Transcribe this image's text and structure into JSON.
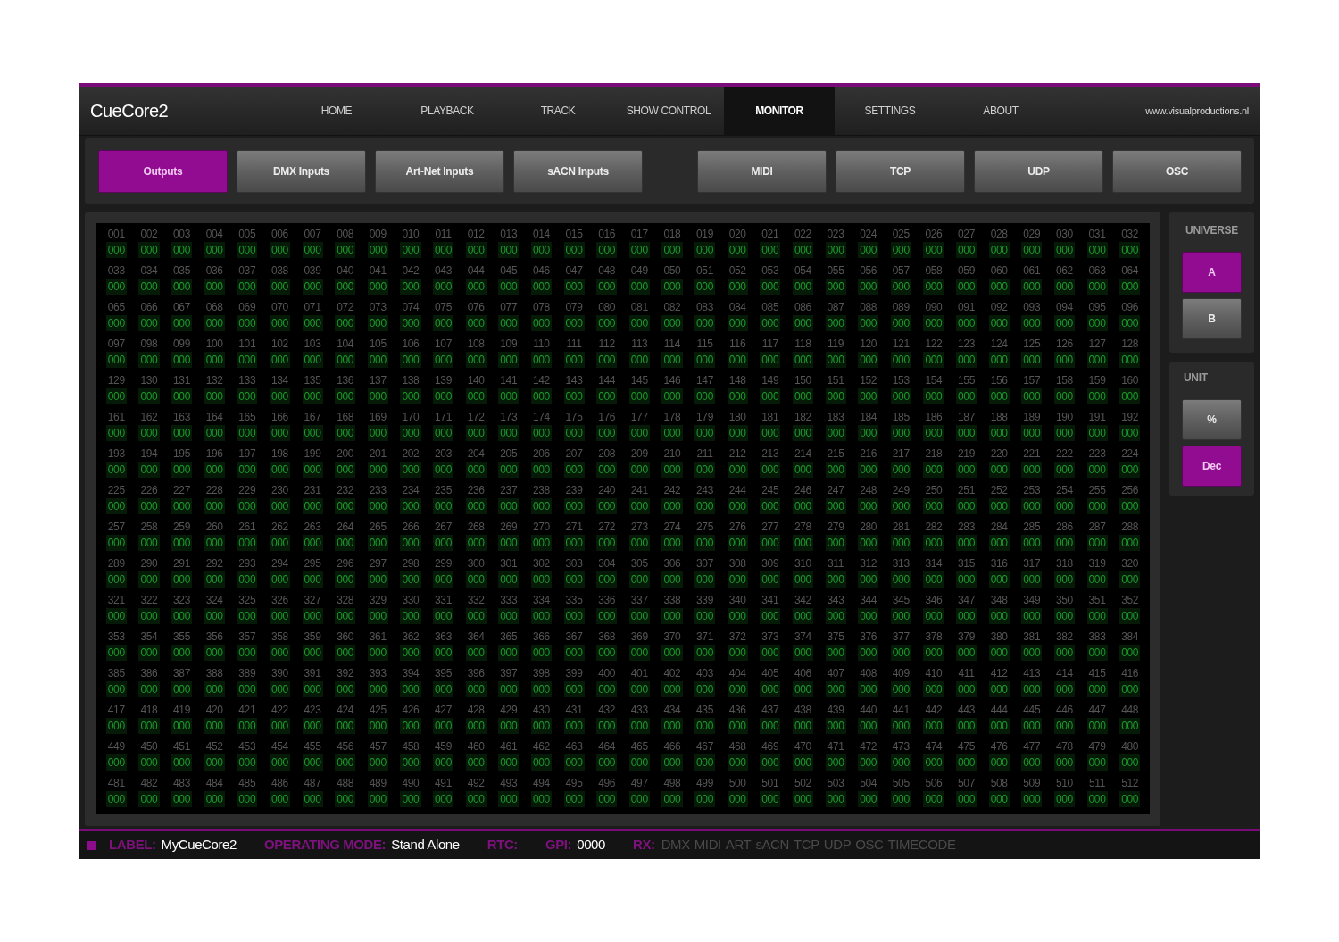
{
  "app": {
    "title": "CueCore2",
    "website": "www.visualproductions.nl"
  },
  "nav_tabs": [
    {
      "label": "HOME",
      "selected": false
    },
    {
      "label": "PLAYBACK",
      "selected": false
    },
    {
      "label": "TRACK",
      "selected": false
    },
    {
      "label": "SHOW CONTROL",
      "selected": false
    },
    {
      "label": "MONITOR",
      "selected": true
    },
    {
      "label": "SETTINGS",
      "selected": false
    },
    {
      "label": "ABOUT",
      "selected": false
    }
  ],
  "channel_tabs": [
    {
      "label": "Outputs",
      "selected": true
    },
    {
      "label": "DMX Inputs",
      "selected": false
    },
    {
      "label": "Art-Net Inputs",
      "selected": false
    },
    {
      "label": "sACN Inputs",
      "selected": false
    }
  ],
  "protocol_tabs": [
    {
      "label": "MIDI",
      "selected": false
    },
    {
      "label": "TCP",
      "selected": false
    },
    {
      "label": "UDP",
      "selected": false
    },
    {
      "label": "OSC",
      "selected": false
    }
  ],
  "channel_rows": [
    {
      "numbers": [
        "001",
        "002",
        "003",
        "004",
        "005",
        "006",
        "007",
        "008",
        "009",
        "010",
        "011",
        "012",
        "013",
        "014",
        "015",
        "016",
        "017",
        "018",
        "019",
        "020",
        "021",
        "022",
        "023",
        "024",
        "025",
        "026",
        "027",
        "028",
        "029",
        "030",
        "031",
        "032"
      ],
      "values": [
        "000",
        "000",
        "000",
        "000",
        "000",
        "000",
        "000",
        "000",
        "000",
        "000",
        "000",
        "000",
        "000",
        "000",
        "000",
        "000",
        "000",
        "000",
        "000",
        "000",
        "000",
        "000",
        "000",
        "000",
        "000",
        "000",
        "000",
        "000",
        "000",
        "000",
        "000",
        "000"
      ]
    },
    {
      "numbers": [
        "033",
        "034",
        "035",
        "036",
        "037",
        "038",
        "039",
        "040",
        "041",
        "042",
        "043",
        "044",
        "045",
        "046",
        "047",
        "048",
        "049",
        "050",
        "051",
        "052",
        "053",
        "054",
        "055",
        "056",
        "057",
        "058",
        "059",
        "060",
        "061",
        "062",
        "063",
        "064"
      ],
      "values": [
        "000",
        "000",
        "000",
        "000",
        "000",
        "000",
        "000",
        "000",
        "000",
        "000",
        "000",
        "000",
        "000",
        "000",
        "000",
        "000",
        "000",
        "000",
        "000",
        "000",
        "000",
        "000",
        "000",
        "000",
        "000",
        "000",
        "000",
        "000",
        "000",
        "000",
        "000",
        "000"
      ]
    },
    {
      "numbers": [
        "065",
        "066",
        "067",
        "068",
        "069",
        "070",
        "071",
        "072",
        "073",
        "074",
        "075",
        "076",
        "077",
        "078",
        "079",
        "080",
        "081",
        "082",
        "083",
        "084",
        "085",
        "086",
        "087",
        "088",
        "089",
        "090",
        "091",
        "092",
        "093",
        "094",
        "095",
        "096"
      ],
      "values": [
        "000",
        "000",
        "000",
        "000",
        "000",
        "000",
        "000",
        "000",
        "000",
        "000",
        "000",
        "000",
        "000",
        "000",
        "000",
        "000",
        "000",
        "000",
        "000",
        "000",
        "000",
        "000",
        "000",
        "000",
        "000",
        "000",
        "000",
        "000",
        "000",
        "000",
        "000",
        "000"
      ]
    },
    {
      "numbers": [
        "097",
        "098",
        "099",
        "100",
        "101",
        "102",
        "103",
        "104",
        "105",
        "106",
        "107",
        "108",
        "109",
        "110",
        "111",
        "112",
        "113",
        "114",
        "115",
        "116",
        "117",
        "118",
        "119",
        "120",
        "121",
        "122",
        "123",
        "124",
        "125",
        "126",
        "127",
        "128"
      ],
      "values": [
        "000",
        "000",
        "000",
        "000",
        "000",
        "000",
        "000",
        "000",
        "000",
        "000",
        "000",
        "000",
        "000",
        "000",
        "000",
        "000",
        "000",
        "000",
        "000",
        "000",
        "000",
        "000",
        "000",
        "000",
        "000",
        "000",
        "000",
        "000",
        "000",
        "000",
        "000",
        "000"
      ]
    },
    {
      "numbers": [
        "129",
        "130",
        "131",
        "132",
        "133",
        "134",
        "135",
        "136",
        "137",
        "138",
        "139",
        "140",
        "141",
        "142",
        "143",
        "144",
        "145",
        "146",
        "147",
        "148",
        "149",
        "150",
        "151",
        "152",
        "153",
        "154",
        "155",
        "156",
        "157",
        "158",
        "159",
        "160"
      ],
      "values": [
        "000",
        "000",
        "000",
        "000",
        "000",
        "000",
        "000",
        "000",
        "000",
        "000",
        "000",
        "000",
        "000",
        "000",
        "000",
        "000",
        "000",
        "000",
        "000",
        "000",
        "000",
        "000",
        "000",
        "000",
        "000",
        "000",
        "000",
        "000",
        "000",
        "000",
        "000",
        "000"
      ]
    },
    {
      "numbers": [
        "161",
        "162",
        "163",
        "164",
        "165",
        "166",
        "167",
        "168",
        "169",
        "170",
        "171",
        "172",
        "173",
        "174",
        "175",
        "176",
        "177",
        "178",
        "179",
        "180",
        "181",
        "182",
        "183",
        "184",
        "185",
        "186",
        "187",
        "188",
        "189",
        "190",
        "191",
        "192"
      ],
      "values": [
        "000",
        "000",
        "000",
        "000",
        "000",
        "000",
        "000",
        "000",
        "000",
        "000",
        "000",
        "000",
        "000",
        "000",
        "000",
        "000",
        "000",
        "000",
        "000",
        "000",
        "000",
        "000",
        "000",
        "000",
        "000",
        "000",
        "000",
        "000",
        "000",
        "000",
        "000",
        "000"
      ]
    },
    {
      "numbers": [
        "193",
        "194",
        "195",
        "196",
        "197",
        "198",
        "199",
        "200",
        "201",
        "202",
        "203",
        "204",
        "205",
        "206",
        "207",
        "208",
        "209",
        "210",
        "211",
        "212",
        "213",
        "214",
        "215",
        "216",
        "217",
        "218",
        "219",
        "220",
        "221",
        "222",
        "223",
        "224"
      ],
      "values": [
        "000",
        "000",
        "000",
        "000",
        "000",
        "000",
        "000",
        "000",
        "000",
        "000",
        "000",
        "000",
        "000",
        "000",
        "000",
        "000",
        "000",
        "000",
        "000",
        "000",
        "000",
        "000",
        "000",
        "000",
        "000",
        "000",
        "000",
        "000",
        "000",
        "000",
        "000",
        "000"
      ]
    },
    {
      "numbers": [
        "225",
        "226",
        "227",
        "228",
        "229",
        "230",
        "231",
        "232",
        "233",
        "234",
        "235",
        "236",
        "237",
        "238",
        "239",
        "240",
        "241",
        "242",
        "243",
        "244",
        "245",
        "246",
        "247",
        "248",
        "249",
        "250",
        "251",
        "252",
        "253",
        "254",
        "255",
        "256"
      ],
      "values": [
        "000",
        "000",
        "000",
        "000",
        "000",
        "000",
        "000",
        "000",
        "000",
        "000",
        "000",
        "000",
        "000",
        "000",
        "000",
        "000",
        "000",
        "000",
        "000",
        "000",
        "000",
        "000",
        "000",
        "000",
        "000",
        "000",
        "000",
        "000",
        "000",
        "000",
        "000",
        "000"
      ]
    },
    {
      "numbers": [
        "257",
        "258",
        "259",
        "260",
        "261",
        "262",
        "263",
        "264",
        "265",
        "266",
        "267",
        "268",
        "269",
        "270",
        "271",
        "272",
        "273",
        "274",
        "275",
        "276",
        "277",
        "278",
        "279",
        "280",
        "281",
        "282",
        "283",
        "284",
        "285",
        "286",
        "287",
        "288"
      ],
      "values": [
        "000",
        "000",
        "000",
        "000",
        "000",
        "000",
        "000",
        "000",
        "000",
        "000",
        "000",
        "000",
        "000",
        "000",
        "000",
        "000",
        "000",
        "000",
        "000",
        "000",
        "000",
        "000",
        "000",
        "000",
        "000",
        "000",
        "000",
        "000",
        "000",
        "000",
        "000",
        "000"
      ]
    },
    {
      "numbers": [
        "289",
        "290",
        "291",
        "292",
        "293",
        "294",
        "295",
        "296",
        "297",
        "298",
        "299",
        "300",
        "301",
        "302",
        "303",
        "304",
        "305",
        "306",
        "307",
        "308",
        "309",
        "310",
        "311",
        "312",
        "313",
        "314",
        "315",
        "316",
        "317",
        "318",
        "319",
        "320"
      ],
      "values": [
        "000",
        "000",
        "000",
        "000",
        "000",
        "000",
        "000",
        "000",
        "000",
        "000",
        "000",
        "000",
        "000",
        "000",
        "000",
        "000",
        "000",
        "000",
        "000",
        "000",
        "000",
        "000",
        "000",
        "000",
        "000",
        "000",
        "000",
        "000",
        "000",
        "000",
        "000",
        "000"
      ]
    },
    {
      "numbers": [
        "321",
        "322",
        "323",
        "324",
        "325",
        "326",
        "327",
        "328",
        "329",
        "330",
        "331",
        "332",
        "333",
        "334",
        "335",
        "336",
        "337",
        "338",
        "339",
        "340",
        "341",
        "342",
        "343",
        "344",
        "345",
        "346",
        "347",
        "348",
        "349",
        "350",
        "351",
        "352"
      ],
      "values": [
        "000",
        "000",
        "000",
        "000",
        "000",
        "000",
        "000",
        "000",
        "000",
        "000",
        "000",
        "000",
        "000",
        "000",
        "000",
        "000",
        "000",
        "000",
        "000",
        "000",
        "000",
        "000",
        "000",
        "000",
        "000",
        "000",
        "000",
        "000",
        "000",
        "000",
        "000",
        "000"
      ]
    },
    {
      "numbers": [
        "353",
        "354",
        "355",
        "356",
        "357",
        "358",
        "359",
        "360",
        "361",
        "362",
        "363",
        "364",
        "365",
        "366",
        "367",
        "368",
        "369",
        "370",
        "371",
        "372",
        "373",
        "374",
        "375",
        "376",
        "377",
        "378",
        "379",
        "380",
        "381",
        "382",
        "383",
        "384"
      ],
      "values": [
        "000",
        "000",
        "000",
        "000",
        "000",
        "000",
        "000",
        "000",
        "000",
        "000",
        "000",
        "000",
        "000",
        "000",
        "000",
        "000",
        "000",
        "000",
        "000",
        "000",
        "000",
        "000",
        "000",
        "000",
        "000",
        "000",
        "000",
        "000",
        "000",
        "000",
        "000",
        "000"
      ]
    },
    {
      "numbers": [
        "385",
        "386",
        "387",
        "388",
        "389",
        "390",
        "391",
        "392",
        "393",
        "394",
        "395",
        "396",
        "397",
        "398",
        "399",
        "400",
        "401",
        "402",
        "403",
        "404",
        "405",
        "406",
        "407",
        "408",
        "409",
        "410",
        "411",
        "412",
        "413",
        "414",
        "415",
        "416"
      ],
      "values": [
        "000",
        "000",
        "000",
        "000",
        "000",
        "000",
        "000",
        "000",
        "000",
        "000",
        "000",
        "000",
        "000",
        "000",
        "000",
        "000",
        "000",
        "000",
        "000",
        "000",
        "000",
        "000",
        "000",
        "000",
        "000",
        "000",
        "000",
        "000",
        "000",
        "000",
        "000",
        "000"
      ]
    },
    {
      "numbers": [
        "417",
        "418",
        "419",
        "420",
        "421",
        "422",
        "423",
        "424",
        "425",
        "426",
        "427",
        "428",
        "429",
        "430",
        "431",
        "432",
        "433",
        "434",
        "435",
        "436",
        "437",
        "438",
        "439",
        "440",
        "441",
        "442",
        "443",
        "444",
        "445",
        "446",
        "447",
        "448"
      ],
      "values": [
        "000",
        "000",
        "000",
        "000",
        "000",
        "000",
        "000",
        "000",
        "000",
        "000",
        "000",
        "000",
        "000",
        "000",
        "000",
        "000",
        "000",
        "000",
        "000",
        "000",
        "000",
        "000",
        "000",
        "000",
        "000",
        "000",
        "000",
        "000",
        "000",
        "000",
        "000",
        "000"
      ]
    },
    {
      "numbers": [
        "449",
        "450",
        "451",
        "452",
        "453",
        "454",
        "455",
        "456",
        "457",
        "458",
        "459",
        "460",
        "461",
        "462",
        "463",
        "464",
        "465",
        "466",
        "467",
        "468",
        "469",
        "470",
        "471",
        "472",
        "473",
        "474",
        "475",
        "476",
        "477",
        "478",
        "479",
        "480"
      ],
      "values": [
        "000",
        "000",
        "000",
        "000",
        "000",
        "000",
        "000",
        "000",
        "000",
        "000",
        "000",
        "000",
        "000",
        "000",
        "000",
        "000",
        "000",
        "000",
        "000",
        "000",
        "000",
        "000",
        "000",
        "000",
        "000",
        "000",
        "000",
        "000",
        "000",
        "000",
        "000",
        "000"
      ]
    },
    {
      "numbers": [
        "481",
        "482",
        "483",
        "484",
        "485",
        "486",
        "487",
        "488",
        "489",
        "490",
        "491",
        "492",
        "493",
        "494",
        "495",
        "496",
        "497",
        "498",
        "499",
        "500",
        "501",
        "502",
        "503",
        "504",
        "505",
        "506",
        "507",
        "508",
        "509",
        "510",
        "511",
        "512"
      ],
      "values": [
        "000",
        "000",
        "000",
        "000",
        "000",
        "000",
        "000",
        "000",
        "000",
        "000",
        "000",
        "000",
        "000",
        "000",
        "000",
        "000",
        "000",
        "000",
        "000",
        "000",
        "000",
        "000",
        "000",
        "000",
        "000",
        "000",
        "000",
        "000",
        "000",
        "000",
        "000",
        "000"
      ]
    }
  ],
  "universe": {
    "heading": "UNIVERSE",
    "options": [
      {
        "label": "A",
        "selected": true
      },
      {
        "label": "B",
        "selected": false
      }
    ]
  },
  "unit": {
    "heading": "UNIT",
    "options": [
      {
        "label": "%",
        "selected": false
      },
      {
        "label": "Dec",
        "selected": true
      }
    ]
  },
  "status_bar": {
    "fields": [
      {
        "label": "LABEL:",
        "value": "MyCueCore2"
      },
      {
        "label": "OPERATING MODE:",
        "value": "Stand Alone"
      },
      {
        "label": "RTC:"
      },
      {
        "label": "GPI:",
        "value": "0000"
      }
    ],
    "rx": {
      "label": "RX:",
      "indicators": [
        {
          "label": "DMX",
          "active": false
        },
        {
          "label": "MIDI",
          "active": false
        },
        {
          "label": "ART",
          "active": false
        },
        {
          "label": "sACN",
          "active": false
        },
        {
          "label": "TCP",
          "active": false
        },
        {
          "label": "UDP",
          "active": false
        },
        {
          "label": "OSC",
          "active": false
        },
        {
          "label": "TIMECODE",
          "active": false
        }
      ]
    }
  }
}
